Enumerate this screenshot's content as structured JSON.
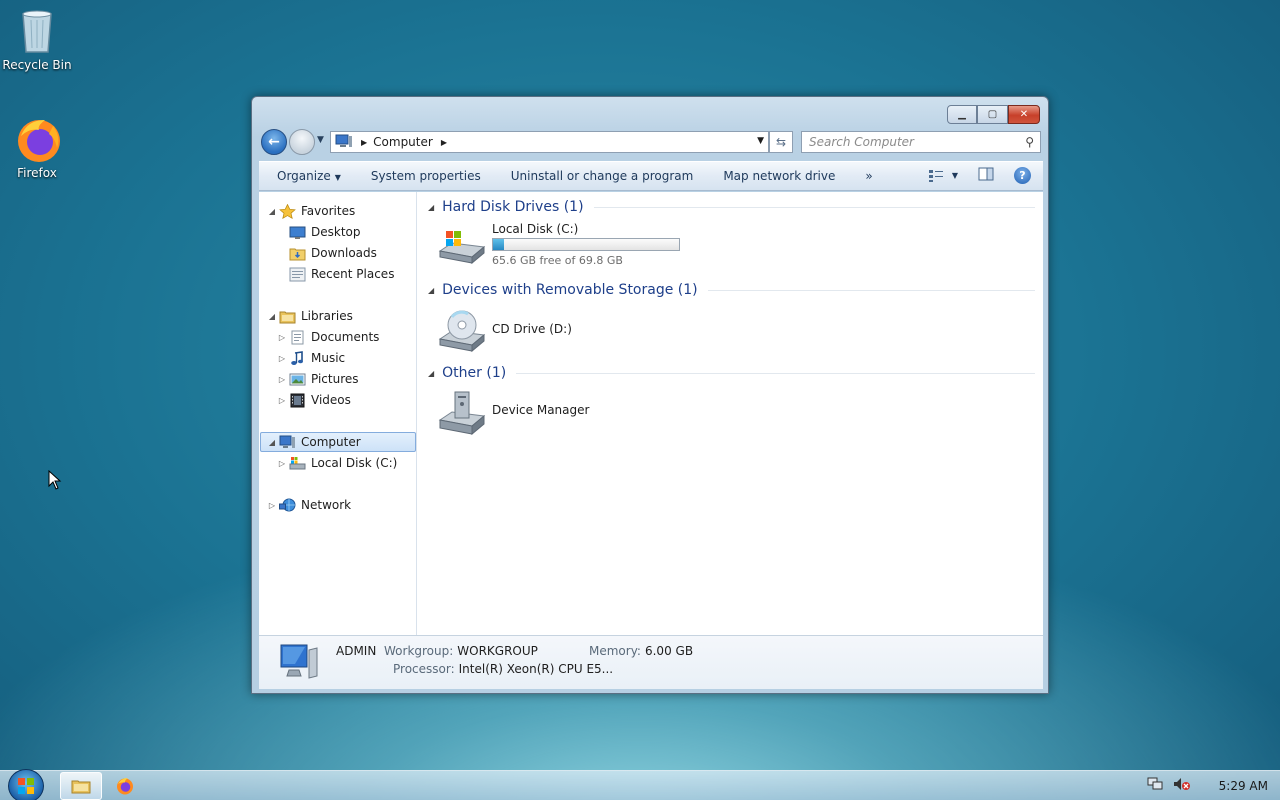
{
  "desktop": {
    "icons": [
      {
        "label": "Recycle Bin",
        "icon": "recycle-bin-icon"
      },
      {
        "label": "Firefox",
        "icon": "firefox-icon"
      }
    ]
  },
  "window": {
    "address": {
      "segment": "Computer"
    },
    "search": {
      "placeholder": "Search Computer"
    },
    "commands": {
      "organize": "Organize",
      "system_properties": "System properties",
      "uninstall": "Uninstall or change a program",
      "map_drive": "Map network drive",
      "more": "»"
    },
    "nav": {
      "favorites": "Favorites",
      "desktop": "Desktop",
      "downloads": "Downloads",
      "recent": "Recent Places",
      "libraries": "Libraries",
      "documents": "Documents",
      "music": "Music",
      "pictures": "Pictures",
      "videos": "Videos",
      "computer": "Computer",
      "local_disk": "Local Disk (C:)",
      "network": "Network"
    },
    "groups": {
      "hdd": {
        "title": "Hard Disk Drives (1)",
        "name": "Local Disk (C:)",
        "free": "65.6 GB free of 69.8 GB",
        "used_fraction": 0.06
      },
      "removable": {
        "title": "Devices with Removable Storage (1)",
        "name": "CD Drive (D:)"
      },
      "other": {
        "title": "Other (1)",
        "name": "Device Manager"
      }
    },
    "details": {
      "name": "ADMIN",
      "workgroup_label": "Workgroup:",
      "workgroup": "WORKGROUP",
      "memory_label": "Memory:",
      "memory": "6.00 GB",
      "processor_label": "Processor:",
      "processor": "Intel(R) Xeon(R) CPU E5..."
    }
  },
  "taskbar": {
    "clock": "5:29 AM"
  }
}
